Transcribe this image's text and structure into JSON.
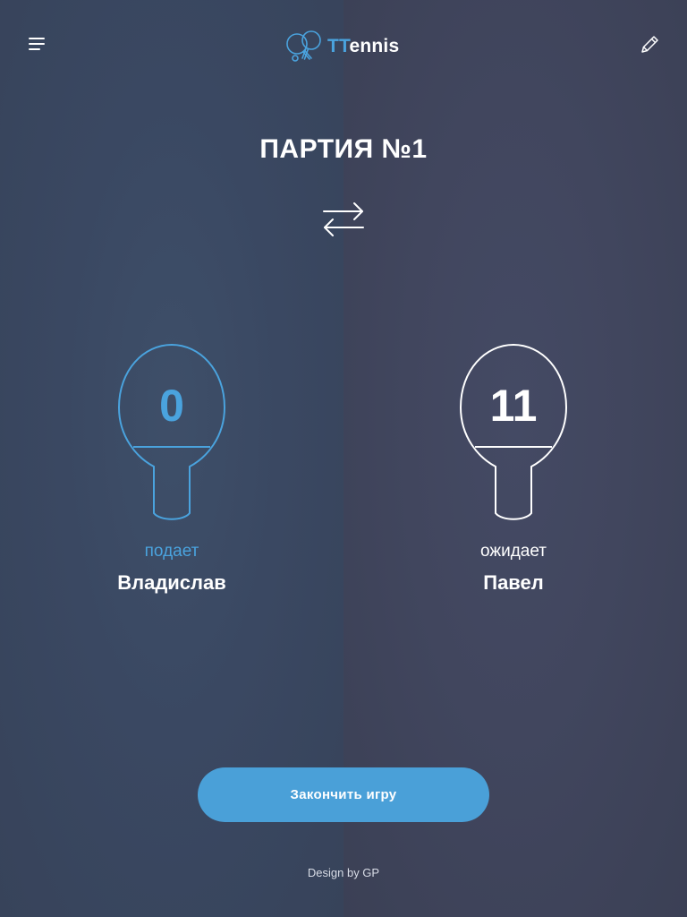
{
  "header": {
    "menu_icon": "hamburger-menu-icon",
    "logo_icon": "ping-pong-paddles-icon",
    "logo_accent": "TT",
    "logo_rest": "ennis",
    "edit_icon": "pencil-icon"
  },
  "game": {
    "title": "ПАРТИЯ №1",
    "swap_icon": "swap-arrows-icon"
  },
  "players": [
    {
      "score": "0",
      "status": "подает",
      "name": "Владислав",
      "serving": true
    },
    {
      "score": "11",
      "status": "ожидает",
      "name": "Павел",
      "serving": false
    }
  ],
  "actions": {
    "finish_label": "Закончить игру"
  },
  "footer": {
    "credit": "Design by GP"
  },
  "colors": {
    "accent": "#4aa3de",
    "button": "#4aa0d8",
    "left_panel": "#3a4862",
    "right_panel": "#41465e",
    "text": "#ffffff"
  }
}
